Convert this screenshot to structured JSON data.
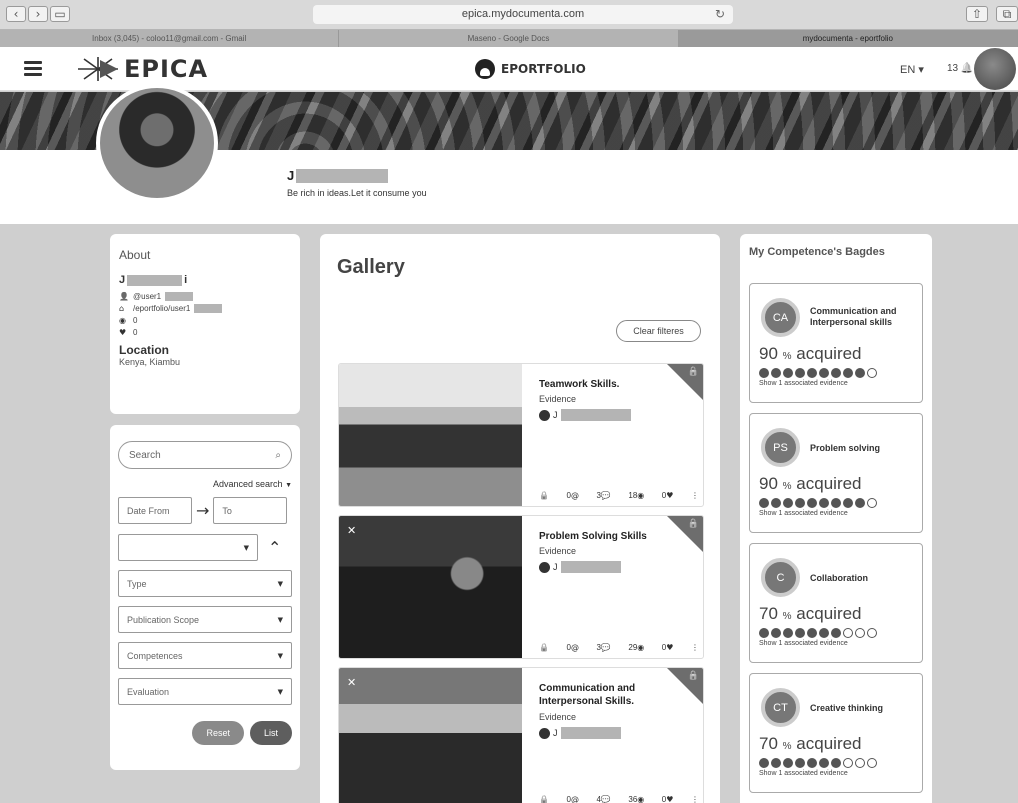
{
  "browser": {
    "url": "epica.mydocumenta.com",
    "tabs": [
      {
        "label": "Inbox (3,045) - coloo11@gmail.com - Gmail"
      },
      {
        "label": "Maseno - Google Docs"
      },
      {
        "label": "mydocumenta - eportfolio"
      }
    ]
  },
  "header": {
    "logo_text": "EPICA",
    "brand_label": "EPORTFOLIO",
    "language": "EN",
    "notifications": "13"
  },
  "profile": {
    "name_initial": "J",
    "tagline": "Be rich in ideas.Let it consume you"
  },
  "about": {
    "title": "About",
    "name_initial": "J",
    "name_end": "i",
    "username": "@user1",
    "url": "/eportfolio/user1",
    "views": "0",
    "likes": "0",
    "location_title": "Location",
    "location_value": "Kenya, Kiambu"
  },
  "filters": {
    "search_placeholder": "Search",
    "advanced_search": "Advanced search",
    "date_from": "Date From",
    "date_to": "To",
    "type": "Type",
    "publication_scope": "Publication Scope",
    "competences": "Competences",
    "evaluation": "Evaluation",
    "reset": "Reset",
    "list": "List"
  },
  "gallery": {
    "title": "Gallery",
    "clear_filters": "Clear filteres",
    "items": [
      {
        "title": "Teamwork Skills.",
        "subtitle": "Evidence",
        "author": "J",
        "comments_a": "0",
        "comments_b": "3",
        "views": "18",
        "likes": "0"
      },
      {
        "title": "Problem Solving Skills",
        "subtitle": "Evidence",
        "author": "J",
        "comments_a": "0",
        "comments_b": "3",
        "views": "29",
        "likes": "0"
      },
      {
        "title": "Communication and Interpersonal Skills.",
        "subtitle": "Evidence",
        "author": "J",
        "comments_a": "0",
        "comments_b": "4",
        "views": "36",
        "likes": "0"
      }
    ]
  },
  "badges": {
    "title": "My Competence's Bagdes",
    "items": [
      {
        "abbr": "CA",
        "name": "Communication and Interpersonal skills",
        "pct": "90",
        "unit": "%",
        "acquired": "acquired",
        "filled": 9,
        "evidence": "Show 1 associated evidence"
      },
      {
        "abbr": "PS",
        "name": "Problem solving",
        "pct": "90",
        "unit": "%",
        "acquired": "acquired",
        "filled": 9,
        "evidence": "Show 1 associated evidence"
      },
      {
        "abbr": "C",
        "name": "Collaboration",
        "pct": "70",
        "unit": "%",
        "acquired": "acquired",
        "filled": 7,
        "evidence": "Show 1 associated evidence"
      },
      {
        "abbr": "CT",
        "name": "Creative thinking",
        "pct": "70",
        "unit": "%",
        "acquired": "acquired",
        "filled": 7,
        "evidence": "Show 1 associated evidence"
      }
    ]
  }
}
